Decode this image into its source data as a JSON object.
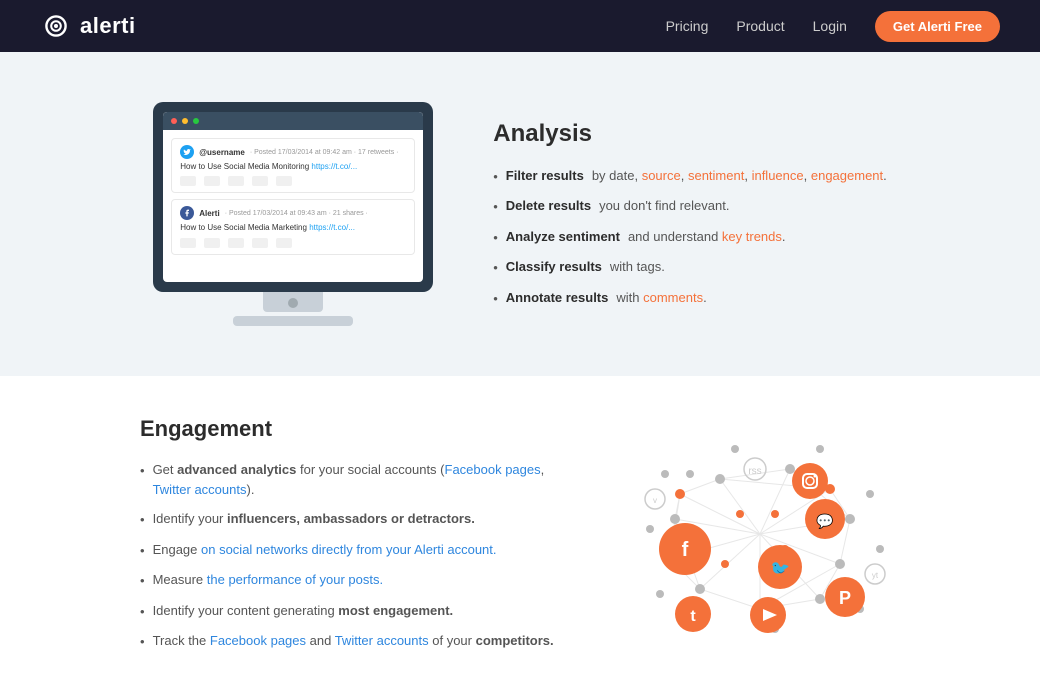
{
  "header": {
    "logo_text": "alerti",
    "nav": {
      "pricing": "Pricing",
      "product": "Product",
      "login": "Login",
      "cta": "Get Alerti Free"
    }
  },
  "analysis": {
    "title": "Analysis",
    "items": [
      {
        "bold": "Filter results",
        "normal": " by date, ",
        "links": [
          "source",
          "sentiment",
          "influence",
          "engagement"
        ],
        "trail": ""
      },
      {
        "bold": "Delete results",
        "normal": " you don't find relevant.",
        "links": []
      },
      {
        "bold": "Analyze sentiment",
        "normal": " and understand ",
        "links": [
          "key trends"
        ],
        "trail": "."
      },
      {
        "bold": "Classify results",
        "normal": " with tags.",
        "links": []
      },
      {
        "bold": "Annotate results",
        "normal": " with ",
        "links": [
          "comments"
        ],
        "trail": "."
      }
    ],
    "tweet1": {
      "username": "@username",
      "time": "Posted 17/03/2014 at 09:42 am",
      "text": "How to Use Social Media Monitoring",
      "link": "https://t.co/..."
    },
    "tweet2": {
      "username": "Alerti",
      "time": "Posted 17/03/2014 at 09:43 am",
      "text": "How to Use Social Media Marketing",
      "link": "https://t.co/..."
    }
  },
  "engagement": {
    "title": "Engagement",
    "items": [
      {
        "bold": "advanced analytics",
        "pre": "Get ",
        "post": " for your social accounts (Facebook pages, Twitter accounts).",
        "links": [
          "Facebook pages",
          "Twitter accounts"
        ]
      },
      {
        "bold": "influencers, ambassadors or detractors.",
        "pre": "Identify your ",
        "post": ""
      },
      {
        "pre": "Engage ",
        "link": "on social networks directly from your Alerti account.",
        "bold": ""
      },
      {
        "pre": "Measure ",
        "link": "the performance of your posts.",
        "bold": ""
      },
      {
        "pre": "Identify your content generating ",
        "bold": "most engagement.",
        "post": ""
      },
      {
        "pre": "Track the Facebook pages and Twitter accounts of your ",
        "bold": "competitors.",
        "links": [
          "Facebook pages",
          "Twitter accounts"
        ]
      }
    ]
  }
}
